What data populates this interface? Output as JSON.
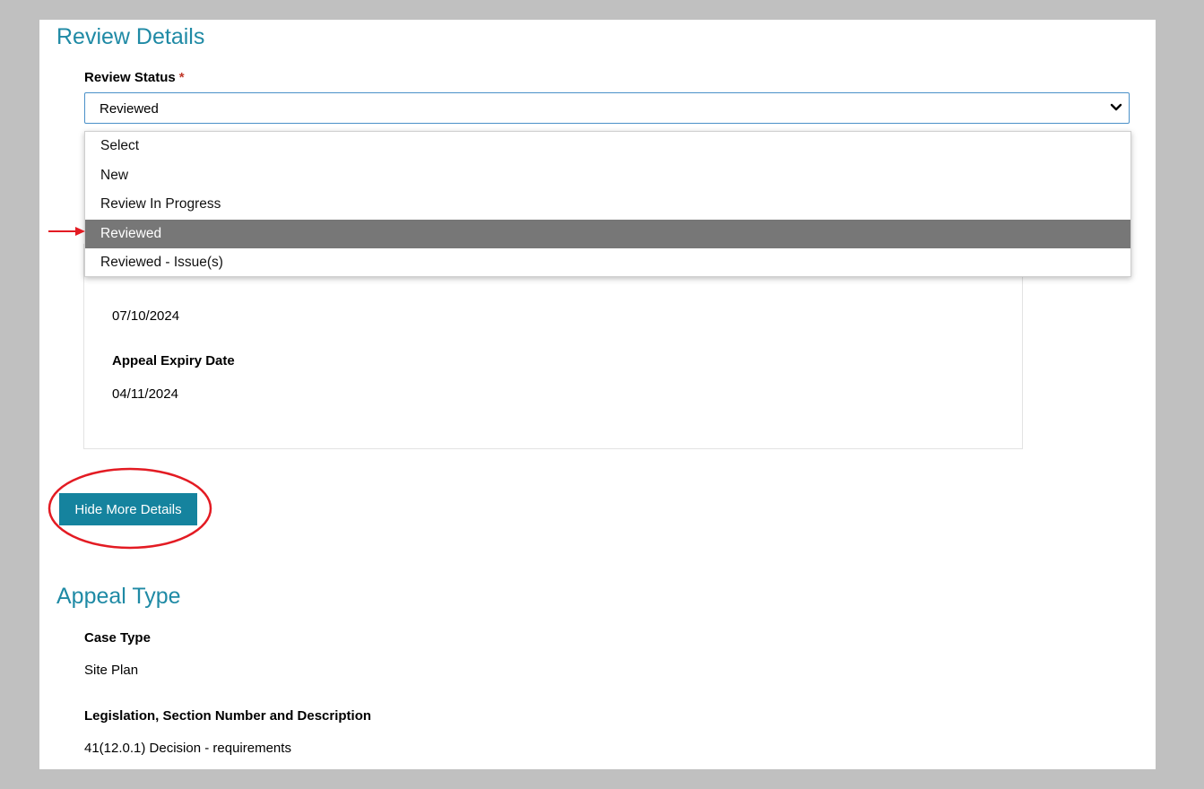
{
  "review_details": {
    "title": "Review Details",
    "review_status_label": "Review Status",
    "required_marker": "*",
    "selected_value": "Reviewed",
    "options": [
      "Select",
      "New",
      "Review In Progress",
      "Reviewed",
      "Reviewed - Issue(s)"
    ],
    "selected_index": 3
  },
  "details_box": {
    "date_value": "07/10/2024",
    "appeal_expiry_label": "Appeal Expiry Date",
    "appeal_expiry_value": "04/11/2024"
  },
  "toggle_button_label": "Hide More Details",
  "appeal_type": {
    "title": "Appeal Type",
    "case_type_label": "Case Type",
    "case_type_value": "Site Plan",
    "legislation_label": "Legislation, Section Number and Description",
    "legislation_value": "41(12.0.1) Decision - requirements"
  },
  "colors": {
    "accent": "#1f8aa5",
    "button": "#15839e",
    "selected_option": "#777777",
    "annotation": "#e31b23"
  }
}
